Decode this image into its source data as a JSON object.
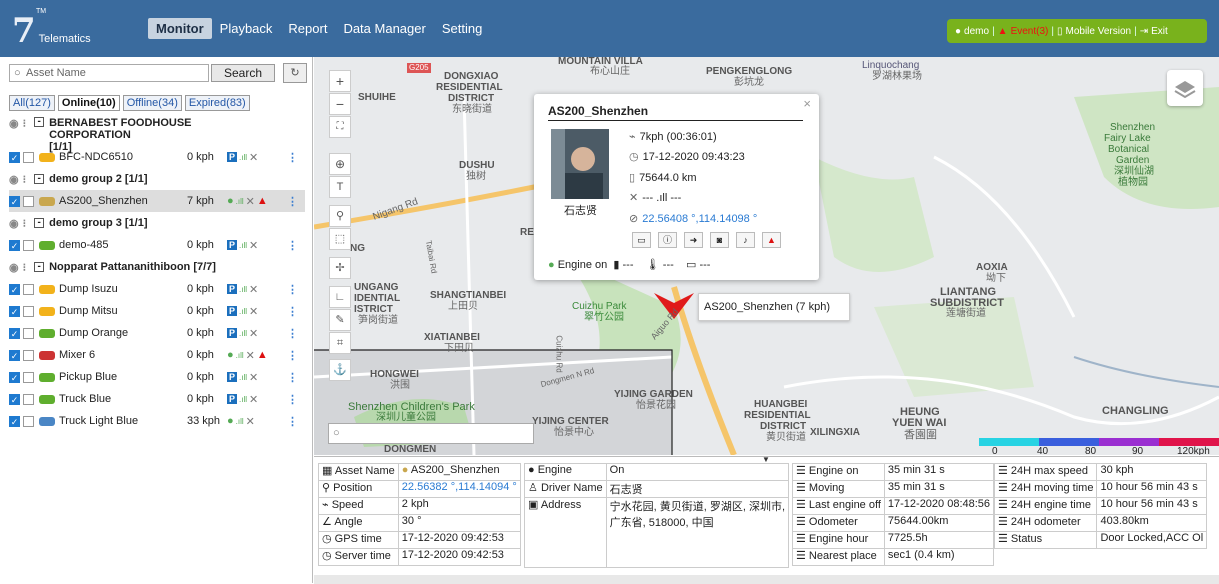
{
  "app": {
    "logo_text": "Telematics",
    "tm": "TM"
  },
  "nav": {
    "monitor": "Monitor",
    "playback": "Playback",
    "report": "Report",
    "data_manager": "Data Manager",
    "setting": "Setting"
  },
  "userbar": {
    "user": "demo",
    "event": "Event(3)",
    "mobile": "Mobile Version",
    "exit": "Exit",
    "sep": "|"
  },
  "search": {
    "placeholder": "Asset Name",
    "button": "Search"
  },
  "tabs": {
    "all": "All(127)",
    "online": "Online(10)",
    "offline": "Offline(34)",
    "expired": "Expired(83)"
  },
  "groups": [
    {
      "name": "BERNABEST FOODHOUSE CORPORATION",
      "count": "[1/1]"
    },
    {
      "name": "demo group 2 [1/1]"
    },
    {
      "name": "demo group 3 [1/1]"
    },
    {
      "name": "Nopparat Pattananithiboon [7/7]"
    }
  ],
  "assets": [
    {
      "name": "BFC-NDC6510",
      "speed": "0 kph",
      "color": "#f2b21b"
    },
    {
      "name": "AS200_Shenzhen",
      "speed": "7 kph",
      "color": "#c9a74e"
    },
    {
      "name": "demo-485",
      "speed": "0 kph",
      "color": "#5fae2e"
    },
    {
      "name": "Dump Isuzu",
      "speed": "0 kph",
      "color": "#f2b21b"
    },
    {
      "name": "Dump Mitsu",
      "speed": "0 kph",
      "color": "#f2b21b"
    },
    {
      "name": "Dump Orange",
      "speed": "0 kph",
      "color": "#5fae2e"
    },
    {
      "name": "Mixer 6",
      "speed": "0 kph",
      "color": "#c33"
    },
    {
      "name": "Pickup Blue",
      "speed": "0 kph",
      "color": "#5fae2e"
    },
    {
      "name": "Truck Blue",
      "speed": "0 kph",
      "color": "#5fae2e"
    },
    {
      "name": "Truck Light Blue",
      "speed": "33 kph",
      "color": "#4a86c5"
    }
  ],
  "popup": {
    "title": "AS200_Shenzhen",
    "speed": "7kph (00:36:01)",
    "time": "17-12-2020 09:43:23",
    "odo": "75644.0 km",
    "signal": "--- .ıll ---",
    "coords": "22.56408 °,114.14098 °",
    "driver": "石志贤",
    "engine": "Engine on",
    "f1": "---",
    "f2": "---",
    "f3": "---"
  },
  "tooltip": "AS200_Shenzhen (7 kph)",
  "map_labels": {
    "dongxiao": "DONGXIAO",
    "residential": "RESIDENTIAL",
    "district": "DISTRICT",
    "dongxiao_cn": "东晓街道",
    "shuihe": "SHUIHE",
    "mountain": "MOUNTAIN VILLA",
    "mountain_cn": "布心山庄",
    "pengkenglong": "PENGKENGLONG",
    "pengkeng_cn": "彭坑龙",
    "linquochang": "Linquochang",
    "lin_cn": "罗湖林果场",
    "dushu": "DUSHU",
    "dushu_cn": "独树",
    "nigang": "Nigang Rd",
    "ungang": "UNGANG",
    "idential": "IDENTIAL",
    "istrict": "ISTRICT",
    "sunggang_cn": "笋岗街道",
    "shangtianbei": "SHANGTIANBEI",
    "shangtian_cn": "上田贝",
    "cuizhu": "Cuizhu Park",
    "cuizhu_cn": "翠竹公园",
    "xiatianbei": "XIATIANBEI",
    "xia_cn": "下田贝",
    "hongwei": "HONGWEI",
    "hongwei_cn": "洪围",
    "children": "Shenzhen Children's Park",
    "children_cn": "深圳儿童公园",
    "yijing": "YIJING CENTER",
    "yijing_cn": "怡景中心",
    "yijing_garden": "YIJING GARDEN",
    "yijing_garden_cn": "怡景花园",
    "huangbei": "HUANGBEI",
    "huangbei_res": "RESIDENTIAL",
    "huangbei_dist": "DISTRICT",
    "huangbei_cn": "黄贝街道",
    "xilingxia": "XILINGXIA",
    "heung": "HEUNG",
    "yuen": "YUEN WAI",
    "yuen_cn": "香園圍",
    "aoxia": "AOXIA",
    "aoxia_cn": "坳下",
    "liantang": "LIANTANG",
    "subdistrict": "SUBDISTRICT",
    "liantang_cn": "莲塘街道",
    "fairy": "Shenzhen",
    "fairy2": "Fairy Lake",
    "fairy3": "Botanical",
    "fairy4": "Garden",
    "fairy_cn": "深圳仙湖",
    "fairy_cn2": "植物园",
    "changling": "CHANGLING",
    "dongmen": "DONGMEN",
    "re": "RE",
    "ng": "NG",
    "dongmen_rd": "Dongmen N Rd",
    "aiguo": "Aiguo Rd",
    "taibai": "Taibai Rd",
    "cuizhu_rd": "Cuizhu Rd",
    "g205": "G205"
  },
  "scale": {
    "t0": "0",
    "t1": "40",
    "t2": "80",
    "t3": "90",
    "t4": "120kph"
  },
  "details": {
    "asset_name_label": "Asset Name",
    "asset_name": "AS200_Shenzhen",
    "position_label": "Position",
    "position": "22.56382 °,114.14094 °",
    "speed_label": "Speed",
    "speed": "2 kph",
    "angle_label": "Angle",
    "angle": "30 °",
    "gps_label": "GPS time",
    "gps": "17-12-2020 09:42:53",
    "server_label": "Server time",
    "server": "17-12-2020 09:42:53",
    "engine_label": "Engine",
    "engine": "On",
    "driver_label": "Driver Name",
    "driver": "石志贤",
    "address_label": "Address",
    "address1": "宁水花园, 黄贝街道, 罗湖区, 深圳市,",
    "address2": "广东省, 518000, 中国",
    "engine_on_label": "Engine on",
    "engine_on": "35 min 31 s",
    "moving_label": "Moving",
    "moving": "35 min 31 s",
    "last_off_label": "Last engine off",
    "last_off": "17-12-2020 08:48:56",
    "odo_label": "Odometer",
    "odo": "75644.00km",
    "engine_hour_label": "Engine hour",
    "engine_hour": "7725.5h",
    "nearest_label": "Nearest place",
    "nearest": "sec1 (0.4 km)",
    "max_speed_label": "24H max speed",
    "max_speed": "30 kph",
    "moving_time_label": "24H moving time",
    "moving_time": "10 hour 56 min 43 s",
    "engine_time_label": "24H engine time",
    "engine_time": "10 hour 56 min 43 s",
    "odo24_label": "24H odometer",
    "odo24": "403.80km",
    "status_label": "Status",
    "status": "Door Locked,ACC Ol"
  }
}
